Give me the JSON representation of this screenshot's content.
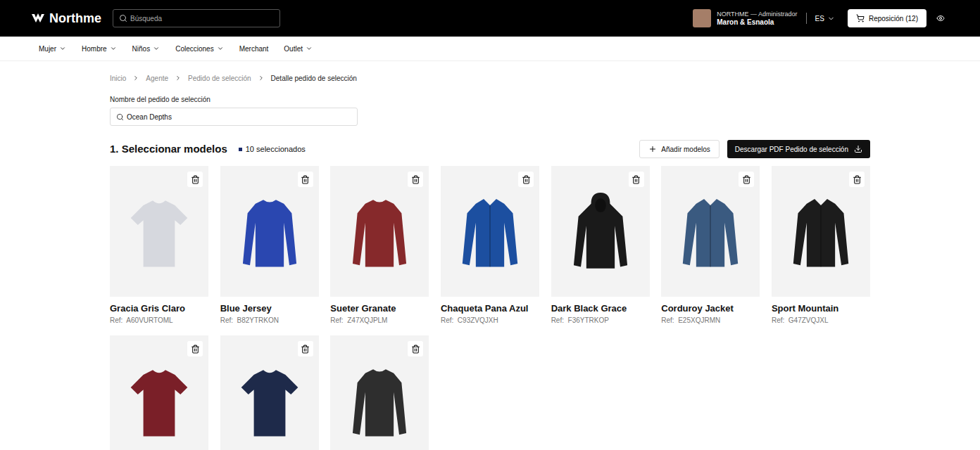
{
  "header": {
    "brand": "Northme",
    "search": {
      "placeholder": "Búsqueda"
    },
    "user": {
      "role": "NORTHME — Administrador",
      "name": "Maron & Esnaola"
    },
    "language": "ES",
    "cart_button": "Reposición (12)"
  },
  "nav": [
    {
      "label": "Mujer",
      "dropdown": true
    },
    {
      "label": "Hombre",
      "dropdown": true
    },
    {
      "label": "Niños",
      "dropdown": true
    },
    {
      "label": "Colecciones",
      "dropdown": true
    },
    {
      "label": "Merchant",
      "dropdown": false
    },
    {
      "label": "Outlet",
      "dropdown": true
    }
  ],
  "breadcrumb": [
    {
      "label": "Inicio",
      "current": false
    },
    {
      "label": "Agente",
      "current": false
    },
    {
      "label": "Pedido de selección",
      "current": false
    },
    {
      "label": "Detalle pedido de selección",
      "current": true
    }
  ],
  "order_name": {
    "label": "Nombre del pedido de selección",
    "value": "Ocean Depths"
  },
  "section": {
    "title": "1. Seleccionar modelos",
    "count": "10 seleccionados",
    "add_button": "Añadir modelos",
    "download_button": "Descargar PDF Pedido de selección"
  },
  "products": [
    {
      "name": "Gracia Gris Claro",
      "ref": "Ref:  A60VURTOML",
      "kind": "tshirt",
      "color": "#d6d8de"
    },
    {
      "name": "Blue Jersey",
      "ref": "Ref:  B82YTRKON",
      "kind": "sweater",
      "color": "#2a47b0"
    },
    {
      "name": "Sueter Granate",
      "ref": "Ref:  Z47XQJPLM",
      "kind": "sweater",
      "color": "#86292b"
    },
    {
      "name": "Chaqueta Pana Azul",
      "ref": "Ref:  C93ZVQJXH",
      "kind": "jacket",
      "color": "#1c4fa0"
    },
    {
      "name": "Dark Black Grace",
      "ref": "Ref:  F36YTRKOP",
      "kind": "hoodie",
      "color": "#1a1a1a"
    },
    {
      "name": "Corduroy Jacket",
      "ref": "Ref:  E25XQJRMN",
      "kind": "jacket",
      "color": "#3a5a80"
    },
    {
      "name": "Sport Mountain",
      "ref": "Ref:  G47ZVQJXL",
      "kind": "jacket",
      "color": "#1c1c1c"
    },
    {
      "kind": "tshirt",
      "color": "#7a1f28"
    },
    {
      "kind": "tshirt",
      "color": "#1e2a4a"
    },
    {
      "kind": "sweater",
      "color": "#2e2e2e"
    }
  ]
}
